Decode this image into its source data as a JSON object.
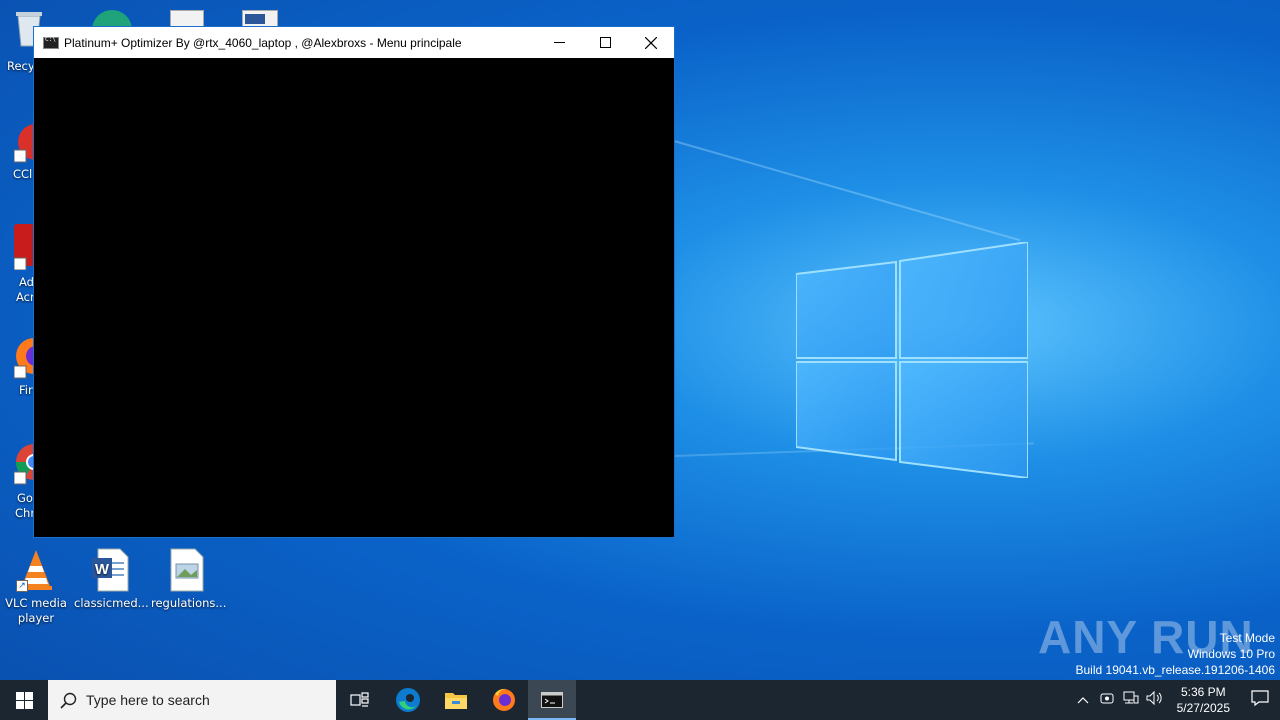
{
  "window": {
    "title": "Platinum+ Optimizer By @rtx_4060_laptop , @Alexbroxs - Menu principale"
  },
  "desktop_icons": [
    {
      "label": "VLC media player"
    },
    {
      "label": "classicmed..."
    },
    {
      "label": "regulations..."
    }
  ],
  "partial_labels": [
    "Recy",
    "CCl",
    "Ad",
    "Acr",
    "Fir",
    "Go",
    "Chr"
  ],
  "watermark": {
    "brand": "ANY RUN",
    "line1": "Test Mode",
    "line2": "Windows 10 Pro",
    "line3": "Build 19041.vb_release.191206-1406"
  },
  "taskbar": {
    "search_placeholder": "Type here to search",
    "time": "5:36 PM",
    "date": "5/27/2025"
  },
  "colors": {
    "taskbar": "#1b2631",
    "desktop": "#0a63c9",
    "console_bg": "#000000"
  }
}
